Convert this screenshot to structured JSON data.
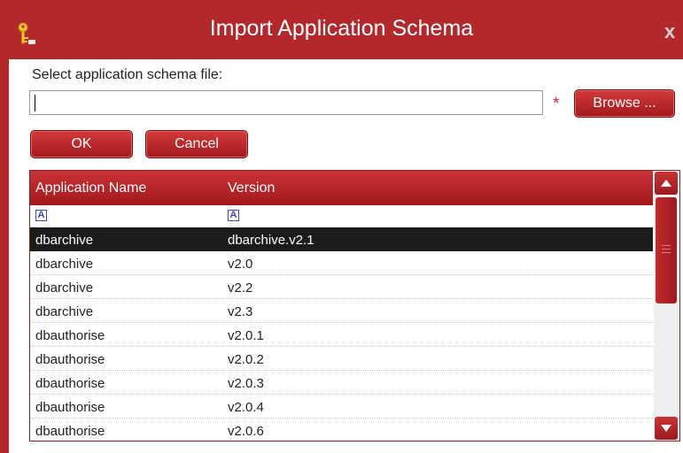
{
  "window": {
    "title": "Import Application Schema",
    "app_icon": "key-icon",
    "close_icon": "close-icon",
    "close_glyph": "x"
  },
  "form": {
    "label": "Select application schema file:",
    "file_value": "",
    "required_mark": "*",
    "browse_label": "Browse ..."
  },
  "actions": {
    "ok_label": "OK",
    "cancel_label": "Cancel"
  },
  "grid": {
    "columns": [
      "Application Name",
      "Version"
    ],
    "filter_glyph": "A",
    "filter_icon": "text-filter-icon",
    "selected_index": 0,
    "rows": [
      {
        "name": "dbarchive",
        "version": "dbarchive.v2.1"
      },
      {
        "name": "dbarchive",
        "version": "v2.0"
      },
      {
        "name": "dbarchive",
        "version": "v2.2"
      },
      {
        "name": "dbarchive",
        "version": "v2.3"
      },
      {
        "name": "dbauthorise",
        "version": "v2.0.1"
      },
      {
        "name": "dbauthorise",
        "version": "v2.0.2"
      },
      {
        "name": "dbauthorise",
        "version": "v2.0.3"
      },
      {
        "name": "dbauthorise",
        "version": "v2.0.4"
      },
      {
        "name": "dbauthorise",
        "version": "v2.0.6"
      }
    ]
  },
  "colors": {
    "accent": "#b2282b",
    "selected_row": "#1c1c1c",
    "required": "#d42a2a"
  }
}
